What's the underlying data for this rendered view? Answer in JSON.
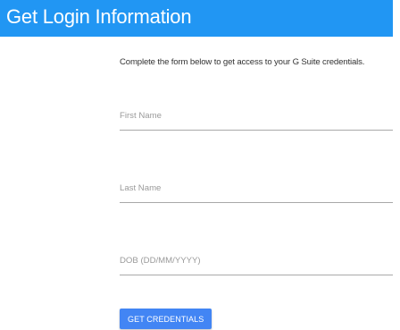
{
  "header": {
    "title": "Get Login Information",
    "background_color": "#2196f3"
  },
  "form": {
    "description": "Complete the form below to get access to your G Suite credentials.",
    "fields": {
      "first_name": {
        "value": "",
        "placeholder": "First Name"
      },
      "last_name": {
        "value": "",
        "placeholder": "Last Name"
      },
      "dob": {
        "value": "",
        "placeholder": "DOB (DD/MM/YYYY)"
      }
    },
    "submit_label": "GET CREDENTIALS",
    "submit_color": "#4285f4"
  }
}
